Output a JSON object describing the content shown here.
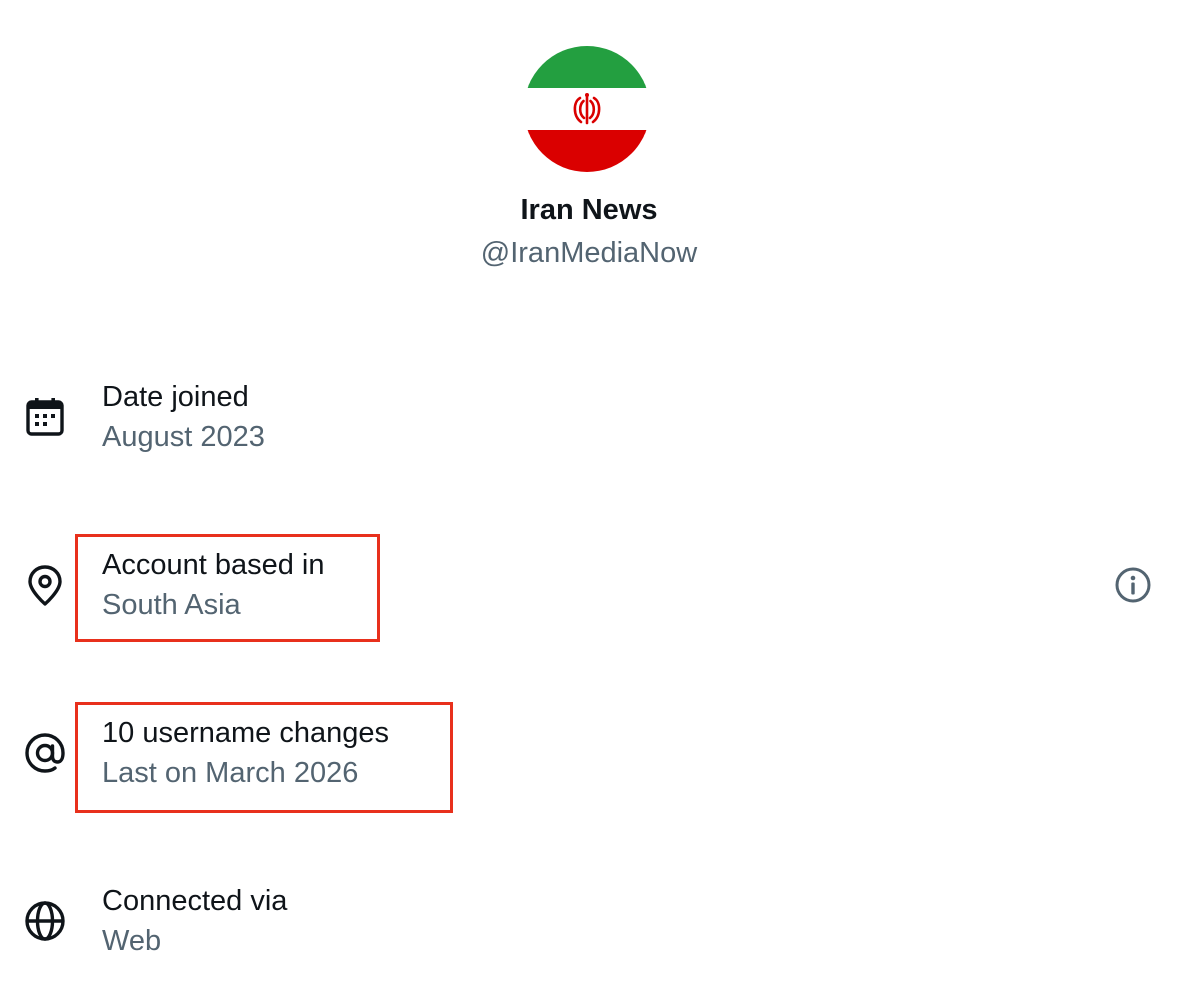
{
  "profile": {
    "display_name": "Iran News",
    "handle": "@IranMediaNow",
    "avatar_icon": "iran-flag-avatar",
    "flag_colors": {
      "green": "#239f40",
      "white": "#ffffff",
      "red": "#da0000"
    }
  },
  "rows": [
    {
      "icon": "calendar-icon",
      "title": "Date joined",
      "subtitle": "August 2023"
    },
    {
      "icon": "location-pin-icon",
      "title": "Account based in",
      "subtitle": "South Asia",
      "highlighted": true,
      "has_info_button": true
    },
    {
      "icon": "at-sign-icon",
      "title": "10 username changes",
      "subtitle": "Last on March 2026",
      "highlighted": true
    },
    {
      "icon": "globe-icon",
      "title": "Connected via",
      "subtitle": "Web"
    }
  ],
  "colors": {
    "primary_text": "#0f1419",
    "secondary_text": "#536471",
    "highlight_border": "#e8301c",
    "background": "#ffffff"
  },
  "info_button": {
    "icon": "info-circle-icon"
  }
}
